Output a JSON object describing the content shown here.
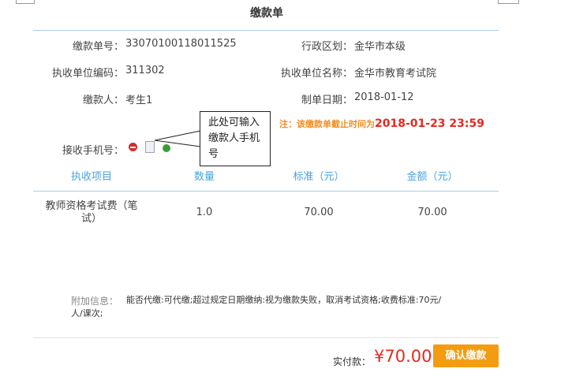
{
  "title": "缴款单",
  "fields": {
    "bill_no": {
      "label": "缴款单号：",
      "value": "33070100118011525"
    },
    "region": {
      "label": "行政区划：",
      "value": "金华市本级"
    },
    "unit_code": {
      "label": "执收单位编码：",
      "value": "311302"
    },
    "unit_name": {
      "label": "执收单位名称：",
      "value": "金华市教育考试院"
    },
    "payer": {
      "label": "缴款人：",
      "value": "考生1"
    },
    "date": {
      "label": "制单日期：",
      "value": "2018-01-12"
    },
    "phone": {
      "label": "接收手机号："
    }
  },
  "deadline": {
    "label": "注：该缴款单截止时间为",
    "value": "2018-01-23 23:59"
  },
  "callout": {
    "lines": [
      "此处可输入",
      "缴款人手机",
      "号"
    ]
  },
  "table": {
    "headers": [
      "执收项目",
      "数量",
      "标准（元）",
      "金额（元）"
    ],
    "rows": [
      {
        "item_line1": "教师资格考试费（笔",
        "item_line2": "试）",
        "qty": "1.0",
        "std": "70.00",
        "amount": "70.00"
      }
    ]
  },
  "extra": {
    "label": "附加信息：",
    "line1": "能否代缴:可代缴;超过规定日期缴纳:视为缴款失败，取消考试资格;收费标准:70元/",
    "line2": "人/课次;"
  },
  "footer": {
    "paid_label": "实付款：",
    "paid_value": "¥70.00",
    "confirm_label": "确认缴款"
  },
  "colors": {
    "accent": "#4aa3df",
    "button": "#f39c12",
    "price": "#e8281f",
    "deadline_note": "#f28c1e"
  }
}
